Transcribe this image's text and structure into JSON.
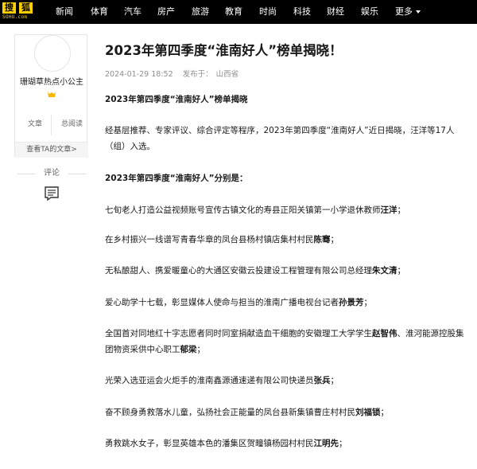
{
  "header": {
    "logo_text_1": "搜",
    "logo_text_2": "狐",
    "logo_url": "SOHU.com",
    "nav": [
      "新闻",
      "体育",
      "汽车",
      "房产",
      "旅游",
      "教育",
      "时尚",
      "科技",
      "财经",
      "娱乐"
    ],
    "more_label": "更多"
  },
  "author": {
    "name": "珊瑚草热点小公主",
    "stats": [
      {
        "label": "文章"
      },
      {
        "label": "总阅读"
      }
    ],
    "view_articles_label": "查看TA的文章>"
  },
  "comment": {
    "label": "评论"
  },
  "article": {
    "title": "2023年第四季度“淮南好人”榜单揭晓！",
    "date": "2024-01-29 18:52",
    "publish_label": "发布于：",
    "location": "山西省",
    "paragraphs": [
      {
        "pre": "2023年第四季度“淮南好人”榜单揭晓",
        "name": "",
        "mid": "",
        "name2": "",
        "post": ""
      },
      {
        "pre": "经基层推荐、专家评议、综合评定等程序，2023年第四季度“淮南好人”近日揭晓，汪洋等17人（组）入选。",
        "name": "",
        "mid": "",
        "name2": "",
        "post": ""
      },
      {
        "pre": "2023年第四季度“淮南好人”分别是：",
        "name": "",
        "mid": "",
        "name2": "",
        "post": ""
      },
      {
        "pre": "七旬老人打造公益视频账号宣传古镇文化的寿县正阳关镇第一小学退休教师",
        "name": "汪洋",
        "mid": "",
        "name2": "",
        "post": "；"
      },
      {
        "pre": "在乡村振兴一线谱写青春华章的凤台县杨村镇店集村村民",
        "name": "陈骞",
        "mid": "",
        "name2": "",
        "post": "；"
      },
      {
        "pre": "无私酿甜人、携爱暖童心的大通区安徽云投建设工程管理有限公司总经理",
        "name": "朱文清",
        "mid": "",
        "name2": "",
        "post": "；"
      },
      {
        "pre": "爱心助学十七载，彰显媒体人使命与担当的淮南广播电视台记者",
        "name": "孙景芳",
        "mid": "",
        "name2": "",
        "post": "；"
      },
      {
        "pre": "全国首对同地红十字志愿者同时同室捐献造血干细胞的安徽理工大学学生",
        "name": "赵智伟",
        "mid": "、淮河能源控股集团物资采供中心职工",
        "name2": "郁梁",
        "post": "；"
      },
      {
        "pre": "光荣入选亚运会火炬手的淮南鑫源通速递有限公司快递员",
        "name": "张兵",
        "mid": "",
        "name2": "",
        "post": "；"
      },
      {
        "pre": "奋不顾身勇救落水儿童，弘扬社会正能量的凤台县新集镇曹庄村村民",
        "name": "刘福锁",
        "mid": "",
        "name2": "",
        "post": "；"
      },
      {
        "pre": "勇救跳水女子，彰显英雄本色的潘集区贺疃镇杨园村村民",
        "name": "江明先",
        "mid": "",
        "name2": "",
        "post": "；"
      }
    ]
  },
  "colors": {
    "topbar": "#000000",
    "logo": "#ffd100",
    "badge": "#f5b800"
  }
}
